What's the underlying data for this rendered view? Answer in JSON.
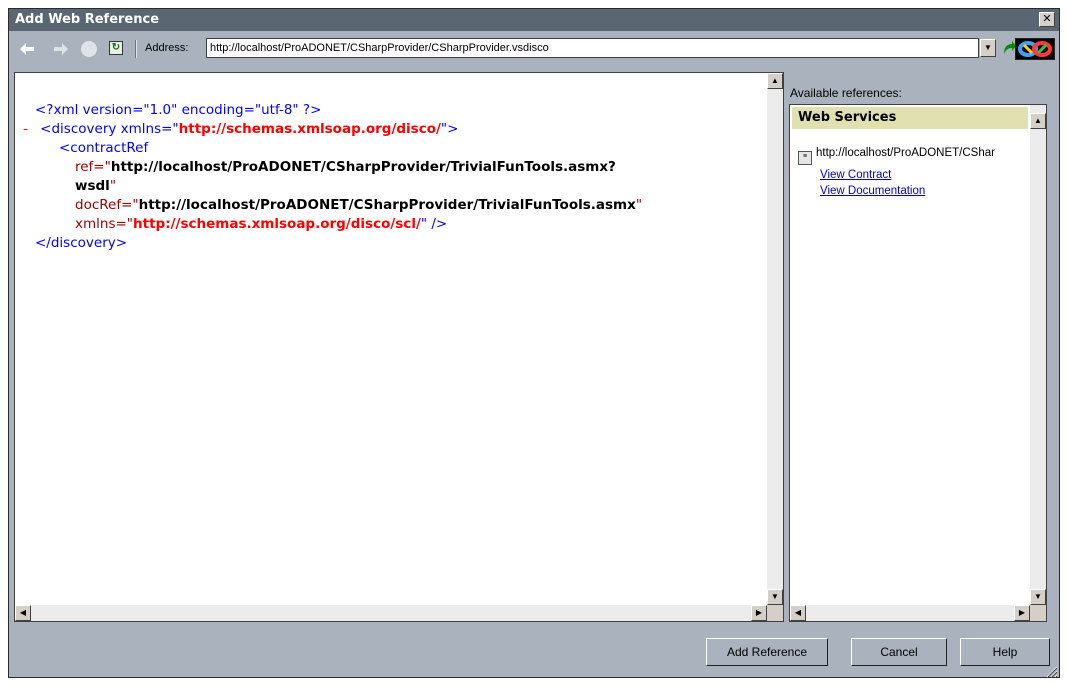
{
  "window": {
    "title": "Add Web Reference",
    "close_glyph": "✕"
  },
  "toolbar": {
    "back_icon": "arrow-left-icon",
    "forward_icon": "arrow-right-icon",
    "stop_icon": "stop-icon",
    "refresh_icon": "refresh-icon",
    "address_label": "Address:",
    "address_value": "http://localhost/ProADONET/CSharpProvider/CSharpProvider.vsdisco",
    "go_icon": "go-arrow-icon"
  },
  "xml_view": {
    "decl": "<?xml version=\"1.0\" encoding=\"utf-8\" ?>",
    "collapse_glyph": "-",
    "discovery_open": "<discovery xmlns=\"",
    "discovery_xmlns_val": "http://schemas.xmlsoap.org/disco/",
    "discovery_open_end": "\">",
    "contract_ref": "<contractRef",
    "ref_attr": "ref=\"",
    "ref_val_line1": "http://localhost/ProADONET/CSharpProvider/TrivialFunTools.asmx?",
    "ref_val_line2": "wsdl",
    "quote": "\"",
    "docref_attr": "docRef=\"",
    "docref_val": "http://localhost/ProADONET/CSharpProvider/TrivialFunTools.asmx",
    "xmlns_attr": "xmlns=\"",
    "xmlns_val": "http://schemas.xmlsoap.org/disco/scl/",
    "xmlns_end": "\" />",
    "discovery_close": "</discovery>"
  },
  "references": {
    "label": "Available references:",
    "section_title": "Web Services",
    "service_url": "http://localhost/ProADONET/CShar",
    "links": [
      "View Contract",
      "View Documentation"
    ]
  },
  "buttons": {
    "add_reference": "Add Reference",
    "cancel": "Cancel",
    "help": "Help"
  }
}
